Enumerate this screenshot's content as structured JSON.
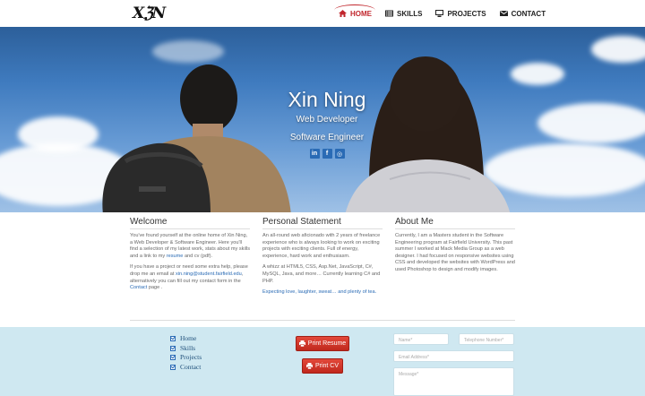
{
  "logo": "XℨN",
  "nav": {
    "items": [
      {
        "label": "HOME",
        "icon": "home-icon",
        "active": true
      },
      {
        "label": "SKILLS",
        "icon": "list-icon",
        "active": false
      },
      {
        "label": "PROJECTS",
        "icon": "monitor-icon",
        "active": false
      },
      {
        "label": "CONTACT",
        "icon": "envelope-icon",
        "active": false
      }
    ],
    "accent": "#c1272d"
  },
  "hero": {
    "name": "Xin Ning",
    "subtitle1": "Web Developer",
    "subtitle2": "Software Engineer",
    "socials": [
      {
        "label": "in",
        "icon": "linkedin-icon"
      },
      {
        "label": "f",
        "icon": "facebook-icon"
      },
      {
        "label": "◎",
        "icon": "github-icon"
      }
    ]
  },
  "welcome": {
    "title": "Welcome",
    "p1_a": "You've found yourself at the online home of Xin Ning, a Web Developer & Software Engineer. Here you'll find a selection of my latest work, stats about my skills and a link to my ",
    "p1_link": "resume",
    "p1_b": " and cv (pdf).",
    "p2_a": "If you have a project or need some extra help, please drop me an email at ",
    "p2_email": "xin.ning@student.fairfield.edu",
    "p2_b": ", alternatively you can fill out my contact form in the ",
    "p2_link": "Contact",
    "p2_c": " page ."
  },
  "personal": {
    "title": "Personal Statement",
    "p1": "An all-round web aficionado with 2 years of freelance experience who is always looking to work on exciting projects with exciting clients. Full of energy, experience, hard work and enthusiasm.",
    "p2": "A whizz at HTML5, CSS, Asp.Net, JavaScript, C#, MySQL, Java, and more… Currently learning C# and PHP.",
    "p3": "Expecting love, laughter, sweat… and plenty of tea."
  },
  "about": {
    "title": "About Me",
    "p1": "Currently, I am a Masters student in the Software Engineering program at Fairfield University. This past summer I worked at Mack Media Group as a web designer. I had focused on responsive websites using CSS and developed the websites with WordPress and used Photoshop to design and modify images."
  },
  "footer": {
    "links": [
      "Home",
      "Skills",
      "Projects",
      "Contact"
    ],
    "print_resume": "Print Resume",
    "print_cv": "Print CV",
    "name_placeholder": "Name*",
    "phone_placeholder": "Telephone Number*",
    "email_placeholder": "Email Address*",
    "message_placeholder": "Message*",
    "bg": "#cfe8f1",
    "button_color": "#d0352a"
  }
}
